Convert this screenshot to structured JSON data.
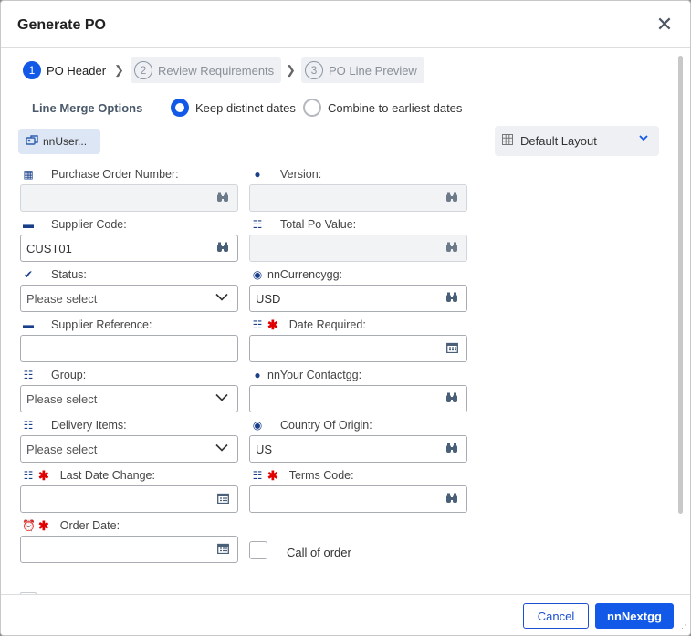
{
  "dialog": {
    "title": "Generate PO",
    "close_label": "✕"
  },
  "steps": [
    {
      "number": "1",
      "label": "PO Header"
    },
    {
      "number": "2",
      "label": "Review Requirements"
    },
    {
      "number": "3",
      "label": "PO Line Preview"
    }
  ],
  "merge": {
    "label": "Line Merge Options",
    "options": [
      {
        "label": "Keep distinct dates",
        "selected": true
      },
      {
        "label": "Combine to earliest dates",
        "selected": false
      }
    ]
  },
  "user_button": {
    "label": "nnUser..."
  },
  "layout": {
    "label": "Default Layout"
  },
  "fields": {
    "purchase_order_number": {
      "label": "Purchase Order Number:",
      "value": ""
    },
    "version": {
      "label": "Version:",
      "value": ""
    },
    "supplier_code": {
      "label": "Supplier Code:",
      "value": "CUST01"
    },
    "total_po_value": {
      "label": "Total Po Value:",
      "value": ""
    },
    "status": {
      "label": "Status:",
      "placeholder": "Please select"
    },
    "currency": {
      "label": "nnCurrencygg:",
      "value": "USD"
    },
    "supplier_reference": {
      "label": "Supplier Reference:",
      "value": ""
    },
    "date_required": {
      "label": "Date Required:",
      "value": ""
    },
    "group": {
      "label": "Group:",
      "placeholder": "Please select"
    },
    "your_contact": {
      "label": "nnYour Contactgg:",
      "value": ""
    },
    "delivery_items": {
      "label": "Delivery Items:",
      "placeholder": "Please select"
    },
    "country_of_origin": {
      "label": "Country Of Origin:",
      "value": "US"
    },
    "last_date_change": {
      "label": "Last Date Change:",
      "value": ""
    },
    "terms_code": {
      "label": "Terms Code:",
      "value": ""
    },
    "order_date": {
      "label": "Order Date:",
      "value": ""
    },
    "call_of_order": {
      "label": "Call of order",
      "checked": false
    }
  },
  "footer": {
    "cancel_label": "Cancel",
    "next_label": "nnNextgg"
  },
  "colors": {
    "accent": "#1259e8",
    "required": "#e00000",
    "icon": "#1a3f8a"
  }
}
